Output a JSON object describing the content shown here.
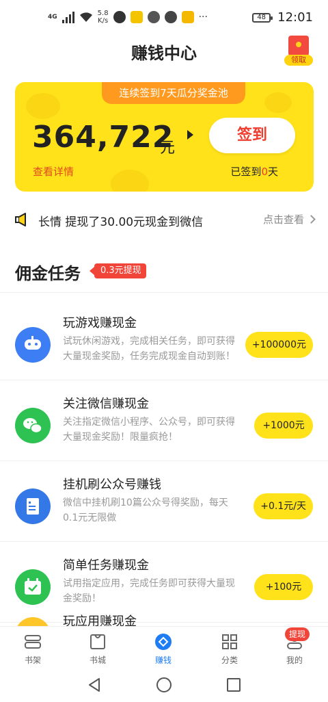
{
  "status_bar": {
    "network": "4G",
    "speed_value": "5.8",
    "speed_unit": "K/s",
    "battery": "48",
    "time": "12:01",
    "more": "···"
  },
  "header": {
    "title": "赚钱中心",
    "redpacket_label": "领取"
  },
  "card": {
    "banner": "连续签到7天瓜分奖金池",
    "amount": "364,722",
    "unit": "元",
    "checkin_button": "签到",
    "detail_link": "查看详情",
    "checked_prefix": "已签到",
    "checked_days": "0",
    "checked_suffix": "天"
  },
  "notice": {
    "text": "长情 提现了30.00元现金到微信",
    "link": "点击查看"
  },
  "section": {
    "title": "佣金任务",
    "badge": "0.3元提现"
  },
  "tasks": [
    {
      "title": "玩游戏赚现金",
      "desc": "试玩休闲游戏，完成相关任务，即可获得大量现金奖励，任务完成现金自动到账！",
      "reward": "+100000元",
      "icon": "gamepad-icon",
      "color": "#3d7ef5"
    },
    {
      "title": "关注微信赚现金",
      "desc": "关注指定微信小程序、公众号，即可获得大量现金奖励！限量疯抢！",
      "reward": "+1000元",
      "icon": "wechat-icon",
      "color": "#2ec252"
    },
    {
      "title": "挂机刷公众号赚钱",
      "desc": "微信中挂机刷10篇公众号得奖励，每天0.1元无限做",
      "reward": "+0.1元/天",
      "icon": "article-icon",
      "color": "#3378e6"
    },
    {
      "title": "简单任务赚现金",
      "desc": "试用指定应用，完成任务即可获得大量现金奖励！",
      "reward": "+100元",
      "icon": "calendar-check-icon",
      "color": "#2ec252"
    },
    {
      "title": "玩应用赚现金",
      "desc": "",
      "reward": "",
      "icon": "app-icon",
      "color": "#ffc62a"
    }
  ],
  "bottom_nav": {
    "items": [
      {
        "label": "书架",
        "icon": "bookshelf-icon"
      },
      {
        "label": "书城",
        "icon": "bookstore-icon"
      },
      {
        "label": "赚钱",
        "icon": "earn-icon"
      },
      {
        "label": "分类",
        "icon": "category-icon"
      },
      {
        "label": "我的",
        "icon": "profile-icon"
      }
    ],
    "active_index": 2,
    "profile_badge": "提现"
  },
  "colors": {
    "accent_yellow": "#ffe21a",
    "accent_orange": "#ff9a1f",
    "accent_red": "#f03c2e",
    "nav_active": "#1e7cf5"
  }
}
